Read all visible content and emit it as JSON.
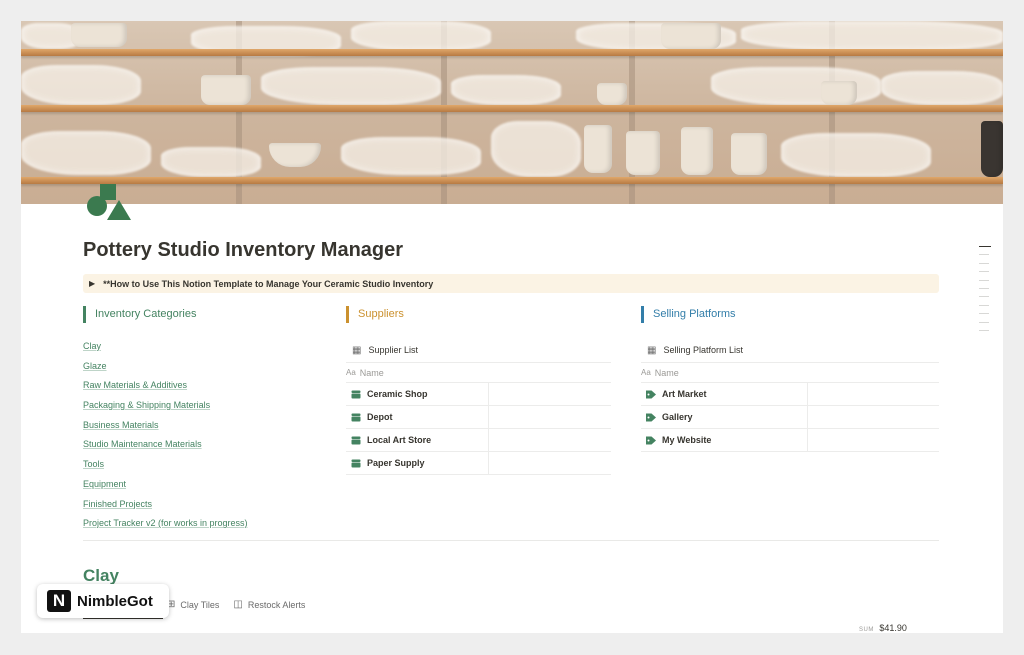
{
  "page": {
    "title": "Pottery Studio Inventory Manager",
    "toggle_text": "**How to Use This Notion Template to Manage Your Ceramic Studio Inventory"
  },
  "inventory": {
    "heading": "Inventory Categories",
    "accent": "#448361",
    "items": [
      "Clay",
      "Glaze",
      "Raw Materials & Additives",
      "Packaging & Shipping Materials",
      "Business Materials",
      "Studio Maintenance Materials",
      "Tools",
      "Equipment",
      "Finished Projects",
      "Project Tracker v2 (for works in progress)"
    ]
  },
  "suppliers": {
    "heading": "Suppliers",
    "accent": "#cb912f",
    "db_title": "Supplier List",
    "column": "Name",
    "rows": [
      "Ceramic Shop",
      "Depot",
      "Local Art Store",
      "Paper Supply"
    ],
    "row_icon": "database-icon"
  },
  "platforms": {
    "heading": "Selling Platforms",
    "accent": "#337ea9",
    "db_title": "Selling Platform List",
    "column": "Name",
    "rows": [
      "Art Market",
      "Gallery",
      "My Website"
    ],
    "row_icon": "tag-icon"
  },
  "clay_section": {
    "heading": "Clay",
    "views": [
      "Clay Tiles",
      "Restock Alerts"
    ],
    "sum_label": "SUM",
    "sum_value": "$41.90"
  },
  "watermark": {
    "letter": "N",
    "text": "NimbleGot"
  }
}
